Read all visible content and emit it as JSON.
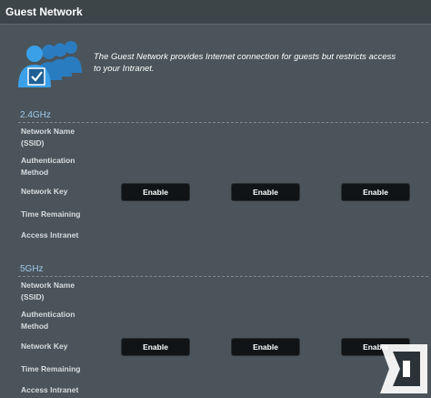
{
  "page": {
    "title": "Guest Network"
  },
  "intro": {
    "description": "The Guest Network provides Internet connection for guests but restricts access to your Intranet."
  },
  "bands": [
    {
      "label": "2.4GHz",
      "fields": [
        "Network Name (SSID)",
        "Authentication Method",
        "Network Key",
        "Time Remaining",
        "Access Intranet"
      ],
      "buttons": [
        "Enable",
        "Enable",
        "Enable"
      ]
    },
    {
      "label": "5GHz",
      "fields": [
        "Network Name (SSID)",
        "Authentication Method",
        "Network Key",
        "Time Remaining",
        "Access Intranet"
      ],
      "buttons": [
        "Enable",
        "Enable",
        "Enable"
      ]
    }
  ],
  "colors": {
    "background": "#4a545a",
    "band_label": "#9fc8ea",
    "button": "#101416",
    "icon_blue": "#2f8fd8"
  },
  "icons": {
    "intro": "guest-users-icon",
    "watermark": "site-logo"
  }
}
